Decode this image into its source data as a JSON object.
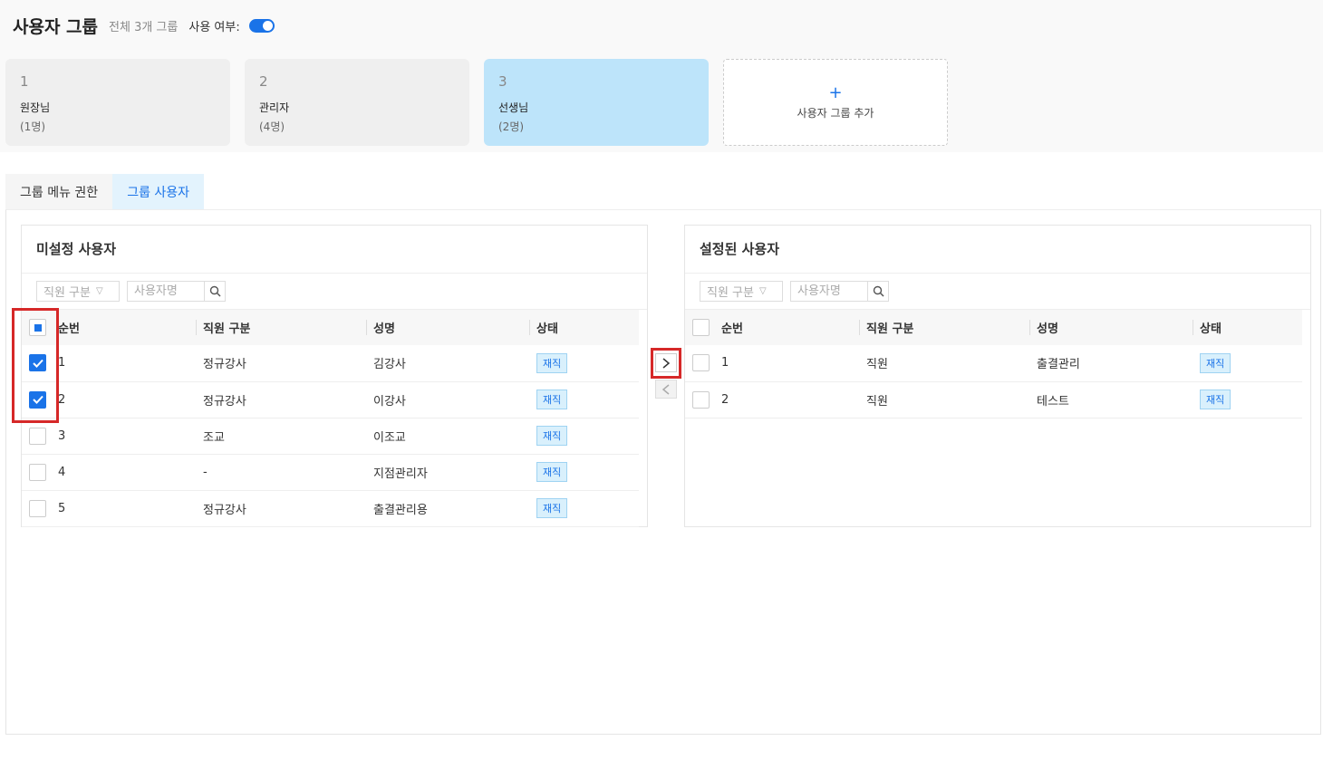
{
  "header": {
    "title": "사용자 그룹",
    "group_count": "전체 3개 그룹",
    "use_label": "사용 여부:",
    "use_enabled": true
  },
  "groups": [
    {
      "num": "1",
      "name": "원장님",
      "count": "(1명)",
      "active": false
    },
    {
      "num": "2",
      "name": "관리자",
      "count": "(4명)",
      "active": false
    },
    {
      "num": "3",
      "name": "선생님",
      "count": "(2명)",
      "active": true
    }
  ],
  "add_group": {
    "icon": "plus-icon",
    "label": "사용자 그룹 추가"
  },
  "tabs": [
    {
      "label": "그룹 메뉴 권한",
      "active": false
    },
    {
      "label": "그룹 사용자",
      "active": true
    }
  ],
  "unassigned": {
    "title": "미설정 사용자",
    "filter_select": "직원 구분",
    "search_placeholder": "사용자명",
    "columns": [
      "순번",
      "직원 구분",
      "성명",
      "상태"
    ],
    "rows": [
      {
        "no": "1",
        "type": "정규강사",
        "name": "김강사",
        "status": "재직",
        "checked": true
      },
      {
        "no": "2",
        "type": "정규강사",
        "name": "이강사",
        "status": "재직",
        "checked": true
      },
      {
        "no": "3",
        "type": "조교",
        "name": "이조교",
        "status": "재직",
        "checked": false
      },
      {
        "no": "4",
        "type": "-",
        "name": "지점관리자",
        "status": "재직",
        "checked": false
      },
      {
        "no": "5",
        "type": "정규강사",
        "name": "출결관리용",
        "status": "재직",
        "checked": false
      }
    ]
  },
  "assigned": {
    "title": "설정된 사용자",
    "filter_select": "직원 구분",
    "search_placeholder": "사용자명",
    "columns": [
      "순번",
      "직원 구분",
      "성명",
      "상태"
    ],
    "rows": [
      {
        "no": "1",
        "type": "직원",
        "name": "출결관리",
        "status": "재직",
        "checked": false
      },
      {
        "no": "2",
        "type": "직원",
        "name": "테스트",
        "status": "재직",
        "checked": false
      }
    ]
  },
  "move": {
    "right": "›",
    "left": "‹"
  },
  "colors": {
    "accent": "#1a73e8",
    "active_card": "#bde4fa",
    "highlight": "#d62828"
  }
}
